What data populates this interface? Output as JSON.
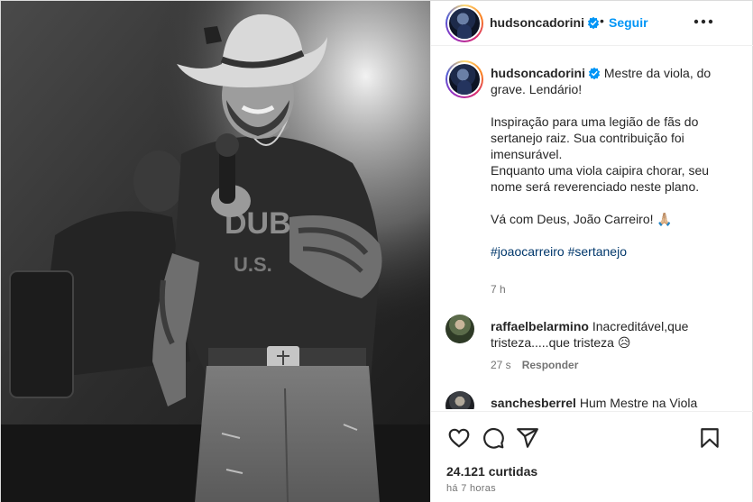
{
  "header": {
    "username": "hudsoncadorini",
    "separator": "•",
    "follow_label": "Seguir",
    "more_icon": "more-horizontal-icon"
  },
  "caption": {
    "username": "hudsoncadorini",
    "line1": "Mestre da viola, do grave. Lendário!",
    "para2": "Inspiração para uma legião de fãs do sertanejo raiz. Sua contribuição foi imensurável.",
    "para3": "Enquanto uma viola caipira chorar, seu nome será reverenciado neste plano.",
    "para4": "Vá com Deus, João Carreiro! 🙏🏼",
    "hashtags": "#joaocarreiro #sertanejo",
    "time": "7 h"
  },
  "comments": [
    {
      "username": "raffaelbelarmino",
      "text": "Inacreditável,que tristeza.....que tristeza 😥",
      "time": "27 s",
      "reply_label": "Responder"
    },
    {
      "username": "sanchesberrel",
      "text": "Hum Mestre na Viola"
    }
  ],
  "actions": {
    "like_icon": "heart-icon",
    "comment_icon": "comment-icon",
    "share_icon": "send-icon",
    "save_icon": "bookmark-icon"
  },
  "likes": "24.121 curtidas",
  "posted": "há 7 horas",
  "colors": {
    "link": "#0095f6",
    "hashtag": "#00376b",
    "muted": "#737373",
    "text": "#262626",
    "verified": "#0095f6"
  }
}
